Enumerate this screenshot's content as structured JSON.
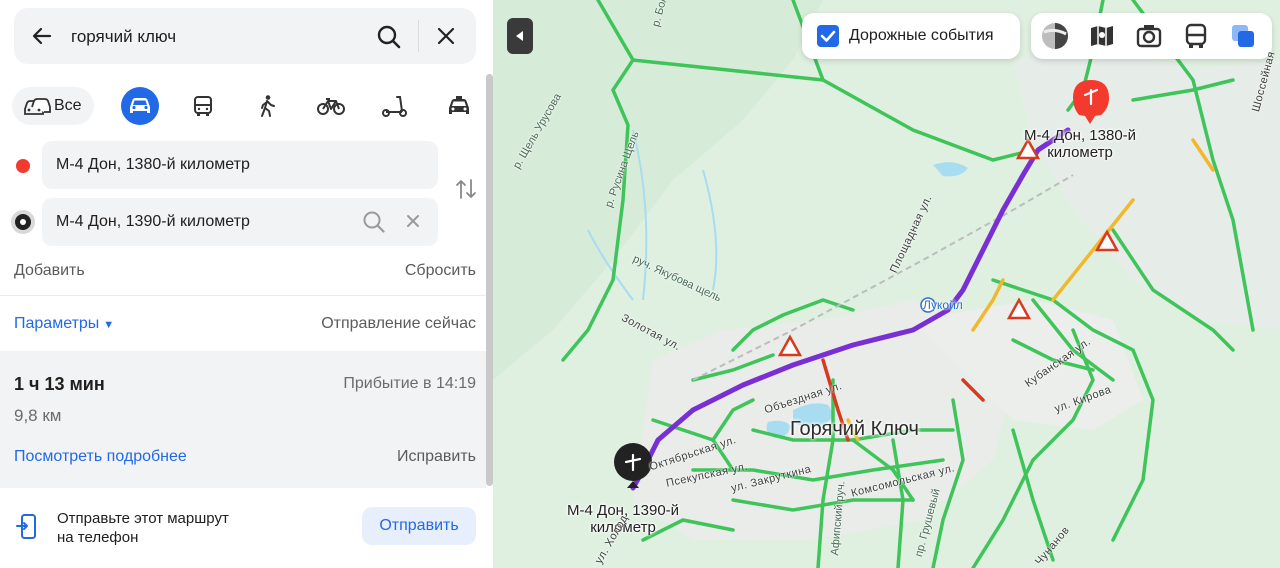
{
  "search": {
    "query": "горячий ключ"
  },
  "modes": {
    "all_label": "Все"
  },
  "route": {
    "from": "М-4 Дон, 1380-й километр",
    "to": "М-4 Дон, 1390-й километр",
    "add_label": "Добавить",
    "reset_label": "Сбросить",
    "params_label": "Параметры",
    "depart_label": "Отправление сейчас"
  },
  "summary": {
    "duration": "1 ч 13 мин",
    "arrival": "Прибытие в 14:19",
    "distance": "9,8 км",
    "details_label": "Посмотреть подробнее",
    "fix_label": "Исправить"
  },
  "send": {
    "text_line1": "Отправьте этот маршрут",
    "text_line2": "на телефон",
    "button_label": "Отправить"
  },
  "map": {
    "traffic_label": "Дорожные события",
    "city": "Горячий Ключ",
    "start_label_line1": "М-4 Дон, 1380-й",
    "start_label_line2": "километр",
    "end_label_line1": "М-4 Дон, 1390-й",
    "end_label_line2": "километр",
    "poi_lukoil": "Лукойл",
    "streets": {
      "s1": "р. Щель Урусова",
      "s2": "р. Русина Щель",
      "s3": "руч. Якубова щель",
      "s4": "Золотая ул.",
      "s5": "Площадная ул.",
      "s6": "Кубанская ул.",
      "s7": "ул. Кирова",
      "s8": "Объездная ул.",
      "s9": "Октябрьская ул.",
      "s10": "Псекупская ул.",
      "s11": "ул. Закруткина",
      "s12": "Комсомольская ул.",
      "s13": "Шоссейная",
      "s14": "р. Бол",
      "s15": "ул. Холод",
      "s16": "пр. Грушевый",
      "s17": "Чунанов",
      "s18": "Афипский руч."
    },
    "colors": {
      "route": "#7a2fd4",
      "road_green": "#3fc45a",
      "road_yellow": "#f2b82c",
      "road_red": "#d63a1f",
      "accent": "#2169e6"
    }
  }
}
